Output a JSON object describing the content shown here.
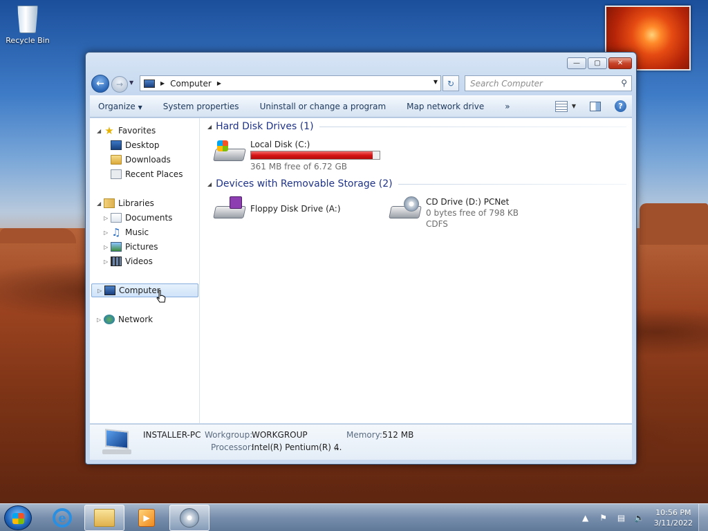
{
  "desktop": {
    "icons": [
      {
        "label": "Recycle Bin",
        "icon": "recycle-bin-icon"
      }
    ]
  },
  "window": {
    "address": {
      "crumb": "Computer"
    },
    "search": {
      "placeholder": "Search Computer"
    },
    "toolbar": {
      "items": [
        "Organize",
        "System properties",
        "Uninstall or change a program",
        "Map network drive"
      ],
      "overflow": "»"
    },
    "nav": {
      "favorites": {
        "label": "Favorites",
        "items": [
          "Desktop",
          "Downloads",
          "Recent Places"
        ]
      },
      "libraries": {
        "label": "Libraries",
        "items": [
          "Documents",
          "Music",
          "Pictures",
          "Videos"
        ]
      },
      "computer": "Computer",
      "network": "Network"
    },
    "groups": [
      {
        "title": "Hard Disk Drives (1)",
        "drives": [
          {
            "name": "Local Disk (C:)",
            "free": "361 MB free of 6.72 GB",
            "used_fraction": 0.948,
            "icon": "hard-disk-icon"
          }
        ]
      },
      {
        "title": "Devices with Removable Storage (2)",
        "drives": [
          {
            "name": "Floppy Disk Drive (A:)",
            "icon": "floppy-drive-icon"
          },
          {
            "name": "CD Drive (D:) PCNet",
            "free": "0 bytes free of 798 KB",
            "fs": "CDFS",
            "icon": "cd-drive-icon"
          }
        ]
      }
    ],
    "details": {
      "computer_name": "INSTALLER-PC",
      "workgroup_label": "Workgroup:",
      "workgroup": "WORKGROUP",
      "memory_label": "Memory:",
      "memory": "512 MB",
      "processor_label": "Processor:",
      "processor": "Intel(R) Pentium(R) 4",
      "ellipsis": "..."
    }
  },
  "taskbar": {
    "clock_time": "10:56 PM",
    "clock_date": "3/11/2022"
  },
  "colors": {
    "usage_bar": "#d81414",
    "group_header": "#1e3287",
    "selection": "#cfe3f9"
  }
}
